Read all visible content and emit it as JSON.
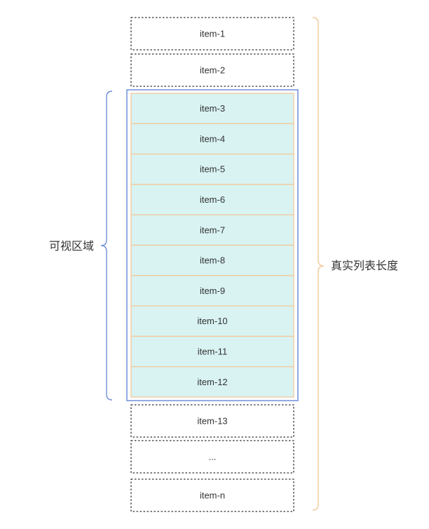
{
  "diagram": {
    "colors": {
      "outside_border": "#333333",
      "visible_fill": "#d8f3f2",
      "visible_item_border": "#f2c99c",
      "viewport_border": "#6f8fd8",
      "total_brace": "#f2c99c",
      "visible_brace": "#6f8fd8",
      "text": "#333333"
    },
    "items_before": [
      "item-1",
      "item-2"
    ],
    "visible_items": [
      "item-3",
      "item-4",
      "item-5",
      "item-6",
      "item-7",
      "item-8",
      "item-9",
      "item-10",
      "item-11",
      "item-12"
    ],
    "items_after": [
      "item-13",
      "...",
      "item-n"
    ],
    "visible_area_label": "可视区域",
    "total_length_label": "真实列表长度"
  }
}
